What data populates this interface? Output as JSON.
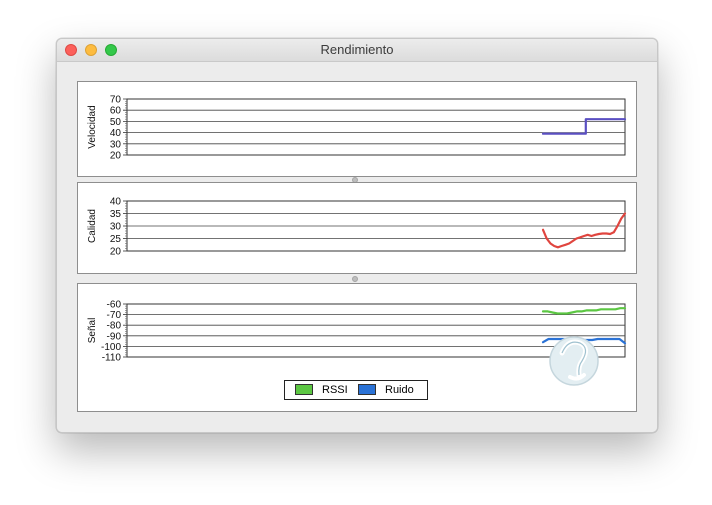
{
  "window": {
    "title": "Rendimiento"
  },
  "colors": {
    "speed": "#5a4fc2",
    "quality": "#e0453f",
    "rssi": "#5cc743",
    "noise": "#2a72d6"
  },
  "charts": {
    "speed": {
      "ylabel": "Velocidad",
      "ticks": [
        "70",
        "60",
        "50",
        "40",
        "30",
        "20"
      ]
    },
    "quality": {
      "ylabel": "Calidad",
      "ticks": [
        "40",
        "35",
        "30",
        "25",
        "20"
      ]
    },
    "signal": {
      "ylabel": "Señal",
      "ticks": [
        "-60",
        "-70",
        "-80",
        "-90",
        "-100",
        "-110"
      ]
    }
  },
  "legend": {
    "rssi": "RSSI",
    "noise": "Ruido"
  },
  "chart_data": [
    {
      "type": "line",
      "ylabel": "Velocidad",
      "ylim": [
        20,
        70
      ],
      "grid": true,
      "series": [
        {
          "values": [
            39,
            39,
            39,
            39,
            39,
            39,
            39,
            39,
            39,
            39,
            39,
            39,
            52,
            52,
            52,
            52,
            52,
            52,
            52,
            52,
            52,
            52,
            52,
            52
          ]
        }
      ]
    },
    {
      "type": "line",
      "ylabel": "Calidad",
      "ylim": [
        20,
        40
      ],
      "grid": true,
      "series": [
        {
          "values": [
            28.5,
            25,
            23,
            22,
            21.5,
            22,
            22.5,
            23,
            24,
            25,
            25.5,
            26,
            26.5,
            26,
            26.5,
            26.8,
            27,
            27,
            26.8,
            27.5,
            30,
            33,
            35
          ]
        }
      ]
    },
    {
      "type": "line",
      "ylabel": "Señal",
      "ylim": [
        -110,
        -60
      ],
      "grid": true,
      "legend_position": "bottom-center",
      "series": [
        {
          "name": "RSSI",
          "values": [
            -67,
            -67,
            -68,
            -69,
            -69,
            -69,
            -68,
            -67,
            -67,
            -66,
            -66,
            -66,
            -65,
            -65,
            -65,
            -65,
            -64,
            -64
          ]
        },
        {
          "name": "Ruido",
          "values": [
            -96,
            -93,
            -93,
            -93,
            -93,
            -94,
            -94,
            -94,
            -94,
            -94,
            -93,
            -93,
            -93,
            -93,
            -93,
            -97
          ]
        }
      ]
    }
  ]
}
